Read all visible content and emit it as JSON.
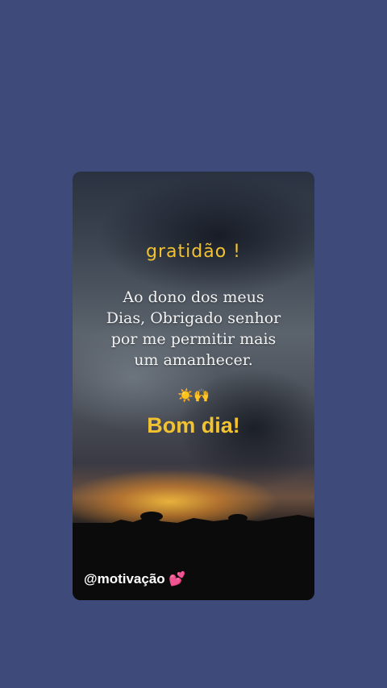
{
  "card": {
    "title": "gratidão !",
    "quote_lines": [
      "Ao dono dos meus",
      "Dias, Obrigado senhor",
      "por me permitir mais",
      "um amanhecer."
    ],
    "emojis": "☀️🙌",
    "greeting": "Bom dia!",
    "handle": "@motivação 💕"
  },
  "colors": {
    "background": "#3d4a7a",
    "accent_yellow": "#f2c230",
    "quote_text": "#f3f3f3"
  },
  "icons": [
    "sun-icon",
    "raised-hands-icon",
    "two-hearts-icon"
  ]
}
